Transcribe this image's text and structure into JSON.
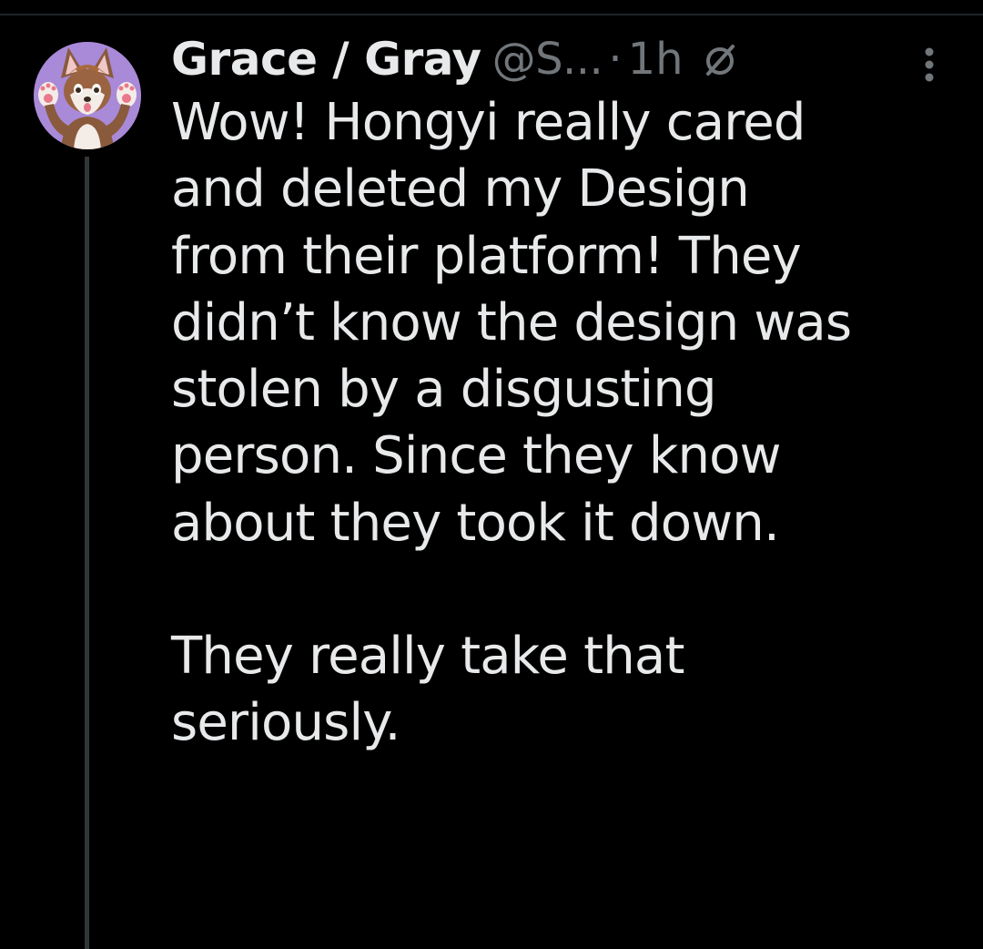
{
  "tweet": {
    "display_name": "Grace / Gray",
    "handle": "@S...",
    "separator": "·",
    "time": "1h",
    "text_lines_p1": [
      "Wow! Hongyi really cared",
      "and deleted my Design",
      "from their platform! They",
      "didn’t know the design was",
      "stolen by a disgusting",
      "person. Since they know",
      "about they took it down."
    ],
    "text_lines_p2": [
      "They really take that",
      "seriously."
    ],
    "icons": {
      "avatar": "avatar-fox-character",
      "edited": "slashed-circle-icon",
      "more": "more-options-vertical-dots-icon"
    }
  },
  "colors": {
    "background": "#000000",
    "primary_text": "#e7e9ea",
    "secondary_text": "#71767b",
    "thread_line": "#333639",
    "avatar_bg": "#a88ad8"
  }
}
